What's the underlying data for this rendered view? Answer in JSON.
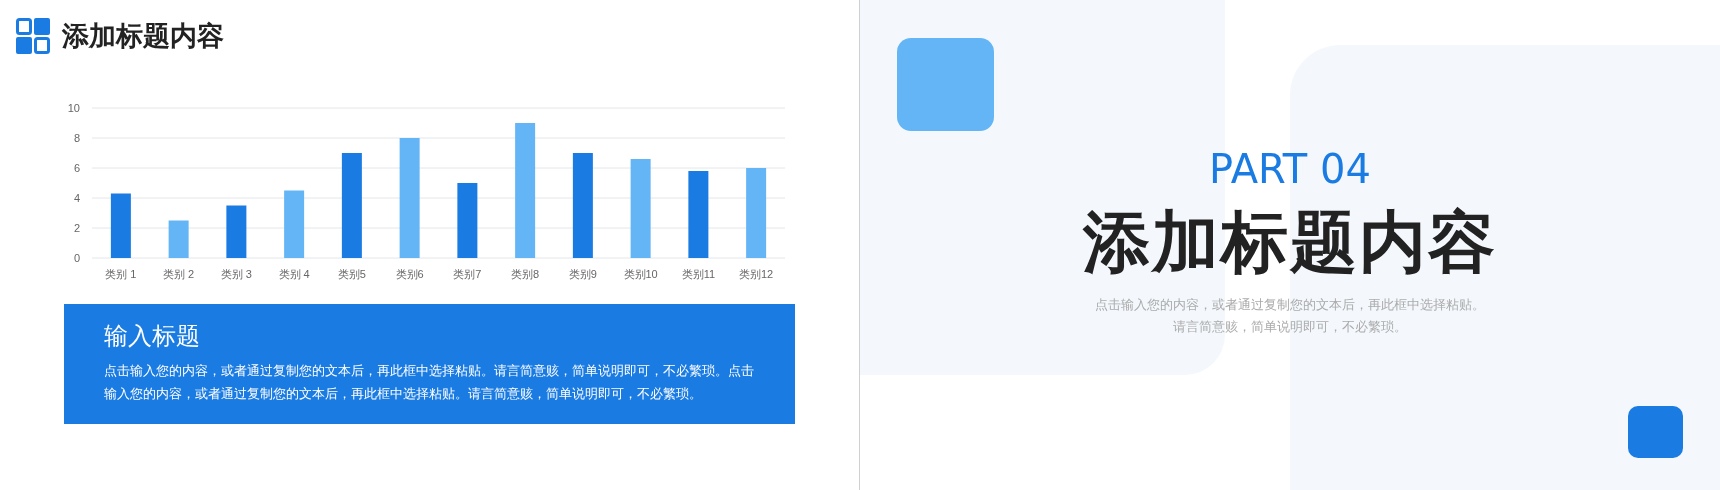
{
  "slides": [
    {
      "title": "添加标题内容",
      "chart_data": {
        "type": "bar",
        "categories": [
          "类别 1",
          "类别 2",
          "类别 3",
          "类别 4",
          "类别5",
          "类别6",
          "类别7",
          "类别8",
          "类别9",
          "类别10",
          "类别11",
          "类别12"
        ],
        "ylim": [
          0,
          10
        ],
        "grid": true,
        "yticks": [
          0,
          2,
          4,
          6,
          8,
          10
        ],
        "series": [
          {
            "color": "#1a7be3",
            "values": [
              4.3,
              null,
              3.5,
              null,
              7,
              null,
              5,
              null,
              7,
              null,
              5.8,
              null
            ]
          },
          {
            "color": "#64b5f6",
            "values": [
              null,
              2.5,
              null,
              4.5,
              null,
              8,
              null,
              9,
              null,
              6.6,
              null,
              6
            ]
          }
        ]
      },
      "text_box": {
        "heading": "输入标题",
        "body": "点击输入您的内容，或者通过复制您的文本后，再此框中选择粘贴。请言简意赅，简单说明即可，不必繁琐。点击输入您的内容，或者通过复制您的文本后，再此框中选择粘贴。请言简意赅，简单说明即可，不必繁琐。"
      }
    },
    {
      "part": "PART 04",
      "title": "添加标题内容",
      "subtitle_lines": [
        "点击输入您的内容，或者通过复制您的文本后，再此框中选择粘贴。",
        "请言简意赅，简单说明即可，不必繁琐。"
      ]
    }
  ]
}
